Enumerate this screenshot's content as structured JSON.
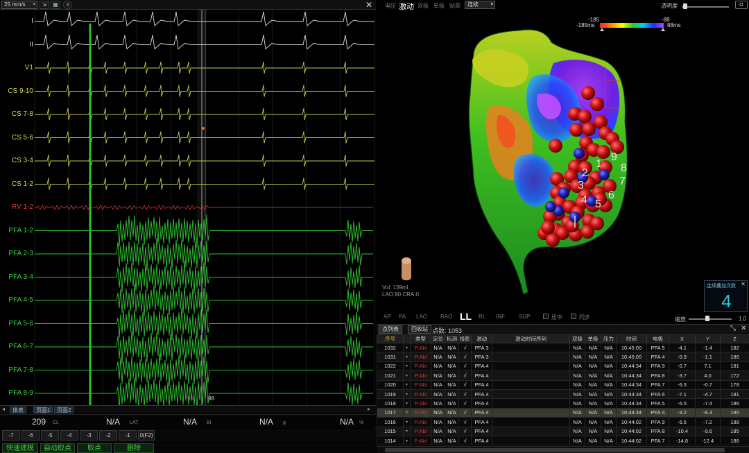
{
  "ecg": {
    "speed": "25 mm/s",
    "marker_98": "98",
    "marker_95": "95",
    "channels": [
      {
        "label": "I",
        "color": "white"
      },
      {
        "label": "II",
        "color": "white"
      },
      {
        "label": "V1",
        "color": "yellow"
      },
      {
        "label": "CS 9-10",
        "color": "yellow"
      },
      {
        "label": "CS 7-8",
        "color": "yellow"
      },
      {
        "label": "CS 5-6",
        "color": "yellow"
      },
      {
        "label": "CS 3-4",
        "color": "yellow"
      },
      {
        "label": "CS 1-2",
        "color": "yellow"
      },
      {
        "label": "RV 1-2",
        "color": "red"
      },
      {
        "label": "PFA 1-2",
        "color": "green"
      },
      {
        "label": "PFA 2-3",
        "color": "green"
      },
      {
        "label": "PFA 3-4",
        "color": "green"
      },
      {
        "label": "PFA 4-5",
        "color": "green"
      },
      {
        "label": "PFA 5-6",
        "color": "green"
      },
      {
        "label": "PFA 6-7",
        "color": "green"
      },
      {
        "label": "PFA 7-8",
        "color": "green"
      },
      {
        "label": "PFA 8-9",
        "color": "green"
      }
    ],
    "tabs": [
      "体表",
      "页面1",
      "页面2"
    ],
    "measures": [
      {
        "value": "209",
        "unit": "CL"
      },
      {
        "value": "N/A",
        "unit": "LAT"
      },
      {
        "value": "N/A",
        "unit": "Bi"
      },
      {
        "value": "N/A",
        "unit": "g"
      },
      {
        "value": "N/A",
        "unit": "%"
      }
    ],
    "offsets": [
      "-7",
      "-6",
      "-5",
      "-4",
      "-3",
      "-2",
      "-1",
      "0(F2)"
    ],
    "actions": [
      "快速建模",
      "自动取点",
      "取点",
      "删除"
    ]
  },
  "map": {
    "modes": [
      "电压",
      "激动",
      "双极",
      "单极",
      "贴靠"
    ],
    "active_mode": "激动",
    "mode_select": "连续",
    "transparency_label": "透明度",
    "colorbar": {
      "min_label": "-185ms",
      "max_label": "-185",
      "right_top": "-88",
      "right_label": "88ms"
    },
    "info_vol": "Vol: 139ml",
    "info_view": "LAO:90 CRA:0",
    "views": [
      "AP",
      "PA",
      "LAO",
      "RAO",
      "LL",
      "RL",
      "INF",
      "SUP"
    ],
    "active_view": "LL",
    "check_center": "居中",
    "check_sync": "同步",
    "overlay_title": "连续叠加次数",
    "overlay_value": "4",
    "zoom_label": "缩放",
    "zoom_value": "1.0",
    "point_labels": [
      "1",
      "2",
      "3",
      "4",
      "5",
      "6",
      "7",
      "8",
      "9"
    ],
    "colors": {
      "red": "#ff2020",
      "blue": "#2030ff",
      "purple": "#b040ff",
      "green": "#20d020"
    }
  },
  "table": {
    "tabs": [
      "点列表",
      "回收站"
    ],
    "point_count_label": "点数: 1053",
    "headers": [
      "序号",
      "",
      "类型",
      "定位",
      "标测",
      "投影",
      "激动",
      "激动时间序列",
      "双极",
      "单极",
      "压力",
      "时间",
      "电极",
      "X",
      "Y",
      "Z"
    ],
    "rows": [
      [
        "1032",
        "P:Abl",
        "N/A",
        "N/A",
        "√",
        "PFA 3",
        "",
        "N/A",
        "N/A",
        "N/A",
        "10:45:00",
        "PFA 5",
        "-4.1",
        "-1.4",
        "182"
      ],
      [
        "1031",
        "P:Abl",
        "N/A",
        "N/A",
        "√",
        "PFA 3",
        "",
        "N/A",
        "N/A",
        "N/A",
        "10:45:00",
        "PFA 4",
        "-0.9",
        "-1.1",
        "186"
      ],
      [
        "1022",
        "P:Abl",
        "N/A",
        "N/A",
        "√",
        "PFA 4",
        "",
        "N/A",
        "N/A",
        "N/A",
        "10:44:34",
        "PFA 9",
        "-0.7",
        "7.1",
        "181"
      ],
      [
        "1021",
        "P:Abl",
        "N/A",
        "N/A",
        "√",
        "PFA 4",
        "",
        "N/A",
        "N/A",
        "N/A",
        "10:44:34",
        "PFA 8",
        "-3.7",
        "4.0",
        "172"
      ],
      [
        "1020",
        "P:Abl",
        "N/A",
        "N/A",
        "√",
        "PFA 4",
        "",
        "N/A",
        "N/A",
        "N/A",
        "10:44:34",
        "PFA 7",
        "-6.3",
        "-0.7",
        "178"
      ],
      [
        "1019",
        "P:Abl",
        "N/A",
        "N/A",
        "√",
        "PFA 4",
        "",
        "N/A",
        "N/A",
        "N/A",
        "10:44:34",
        "PFA 6",
        "-7.1",
        "-4.7",
        "181"
      ],
      [
        "1018",
        "P:Abl",
        "N/A",
        "N/A",
        "√",
        "PFA 4",
        "",
        "N/A",
        "N/A",
        "N/A",
        "10:44:34",
        "PFA 5",
        "-6.5",
        "-7.4",
        "186"
      ],
      [
        "1017",
        "P:Abl",
        "N/A",
        "N/A",
        "√",
        "PFA 4",
        "",
        "N/A",
        "N/A",
        "N/A",
        "10:44:34",
        "PFA 4",
        "-3.2",
        "-6.3",
        "190"
      ],
      [
        "1016",
        "P:Abl",
        "N/A",
        "N/A",
        "√",
        "PFA 4",
        "",
        "N/A",
        "N/A",
        "N/A",
        "10:44:02",
        "PFA 9",
        "-6.5",
        "-7.2",
        "188"
      ],
      [
        "1015",
        "P:Abl",
        "N/A",
        "N/A",
        "√",
        "PFA 4",
        "",
        "N/A",
        "N/A",
        "N/A",
        "10:44:02",
        "PFA 8",
        "-10.4",
        "-9.6",
        "185"
      ],
      [
        "1014",
        "P:Abl",
        "N/A",
        "N/A",
        "√",
        "PFA 4",
        "",
        "N/A",
        "N/A",
        "N/A",
        "10:44:02",
        "PFA 7",
        "-14.8",
        "-12.4",
        "186"
      ]
    ],
    "selected_row": 7
  }
}
